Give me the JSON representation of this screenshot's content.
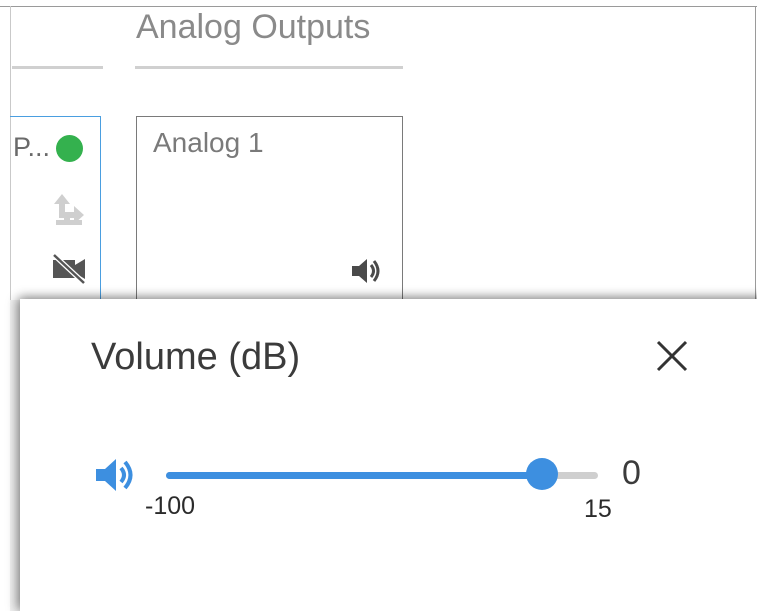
{
  "background": {
    "section_title": "Analog Outputs",
    "left_card": {
      "label": "P...",
      "status_color": "#34b14e",
      "icons": [
        "share-icon",
        "videocam-off-icon"
      ]
    },
    "analog_card": {
      "title": "Analog 1",
      "icon": "volume-icon"
    }
  },
  "modal": {
    "title": "Volume (dB)",
    "close_icon": "close-icon",
    "slider": {
      "icon": "volume-icon",
      "min_label": "-100",
      "max_label": "15",
      "value_label": "0",
      "min": -100,
      "max": 15,
      "value": 0,
      "accent_color": "#3d8fe0"
    }
  }
}
